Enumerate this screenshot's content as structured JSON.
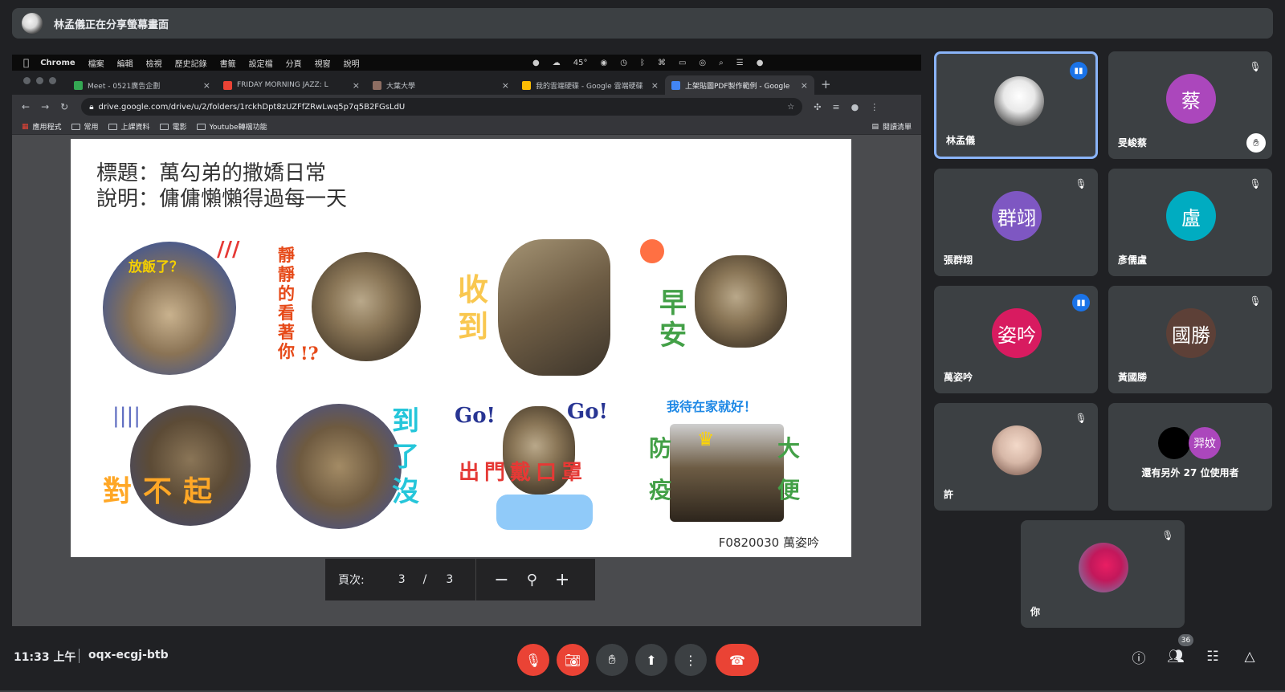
{
  "banner": {
    "text": "林孟儀正在分享螢幕畫面"
  },
  "mac_menu": {
    "items": [
      "Chrome",
      "檔案",
      "編輯",
      "檢視",
      "歷史記錄",
      "書籤",
      "設定檔",
      "分頁",
      "視窗",
      "說明"
    ],
    "temp": "45°"
  },
  "browser": {
    "tabs": [
      {
        "label": "Meet - 0521廣告企劃",
        "color": "#34a853"
      },
      {
        "label": "FRIDAY MORNING JAZZ: L",
        "color": "#ea4335"
      },
      {
        "label": "大葉大學",
        "color": "#8d6e63"
      },
      {
        "label": "我的雲端硬碟 - Google 雲端硬碟",
        "color": "#fbbc04"
      },
      {
        "label": "上架貼圖PDF製作範例 - Google",
        "color": "#4285f4"
      }
    ],
    "url": "drive.google.com/drive/u/2/folders/1rckhDpt8zUZFfZRwLwq5p7q5B2FGsLdU",
    "bookmarks": [
      "應用程式",
      "常用",
      "上課資料",
      "電影",
      "Youtube轉檔功能"
    ],
    "reading_list": "閱讀清單"
  },
  "pdf": {
    "title_line": "標題：萬勾弟的撒嬌日常",
    "desc_line": "說明：傭傭懶懶得過每一天",
    "stickers": [
      "放飯了？",
      "靜靜的看著你",
      "收到",
      "早安",
      "對不起",
      "到了沒",
      "出門戴口罩",
      "我待在家就好！"
    ],
    "sticker_marks": [
      "!?",
      "Go!",
      "Go!",
      "防疫",
      "大便"
    ],
    "signature": "F0820030 萬姿吟"
  },
  "pager": {
    "label": "頁次:",
    "current": "3",
    "separator": "/",
    "total": "3"
  },
  "participants": [
    {
      "name": "林孟儀",
      "initials": "",
      "color": "#f0f0f0",
      "speaking": true
    },
    {
      "name": "旻峻蔡",
      "initials": "蔡",
      "color": "#ab47bc",
      "muted": true,
      "hand": true
    },
    {
      "name": "張群翊",
      "initials": "群翊",
      "color": "#7e57c2",
      "muted": true
    },
    {
      "name": "彥儒盧",
      "initials": "盧",
      "color": "#00acc1",
      "muted": true
    },
    {
      "name": "萬姿吟",
      "initials": "姿吟",
      "color": "#d81b60",
      "speaking": true
    },
    {
      "name": "黃國勝",
      "initials": "國勝",
      "color": "#5d4037",
      "muted": true
    },
    {
      "name": "許",
      "initials": "",
      "color": "#d7b8a8",
      "muted": true
    },
    {
      "name": "還有另外 27 位使用者",
      "initials": "羿妏",
      "color": "#ab47bc"
    },
    {
      "name": "你",
      "initials": "",
      "color": "#c2185b",
      "muted": true
    }
  ],
  "bottom": {
    "time": "11:33 上午",
    "meeting_code": "oqx-ecgj-btb",
    "people_count": "36"
  }
}
